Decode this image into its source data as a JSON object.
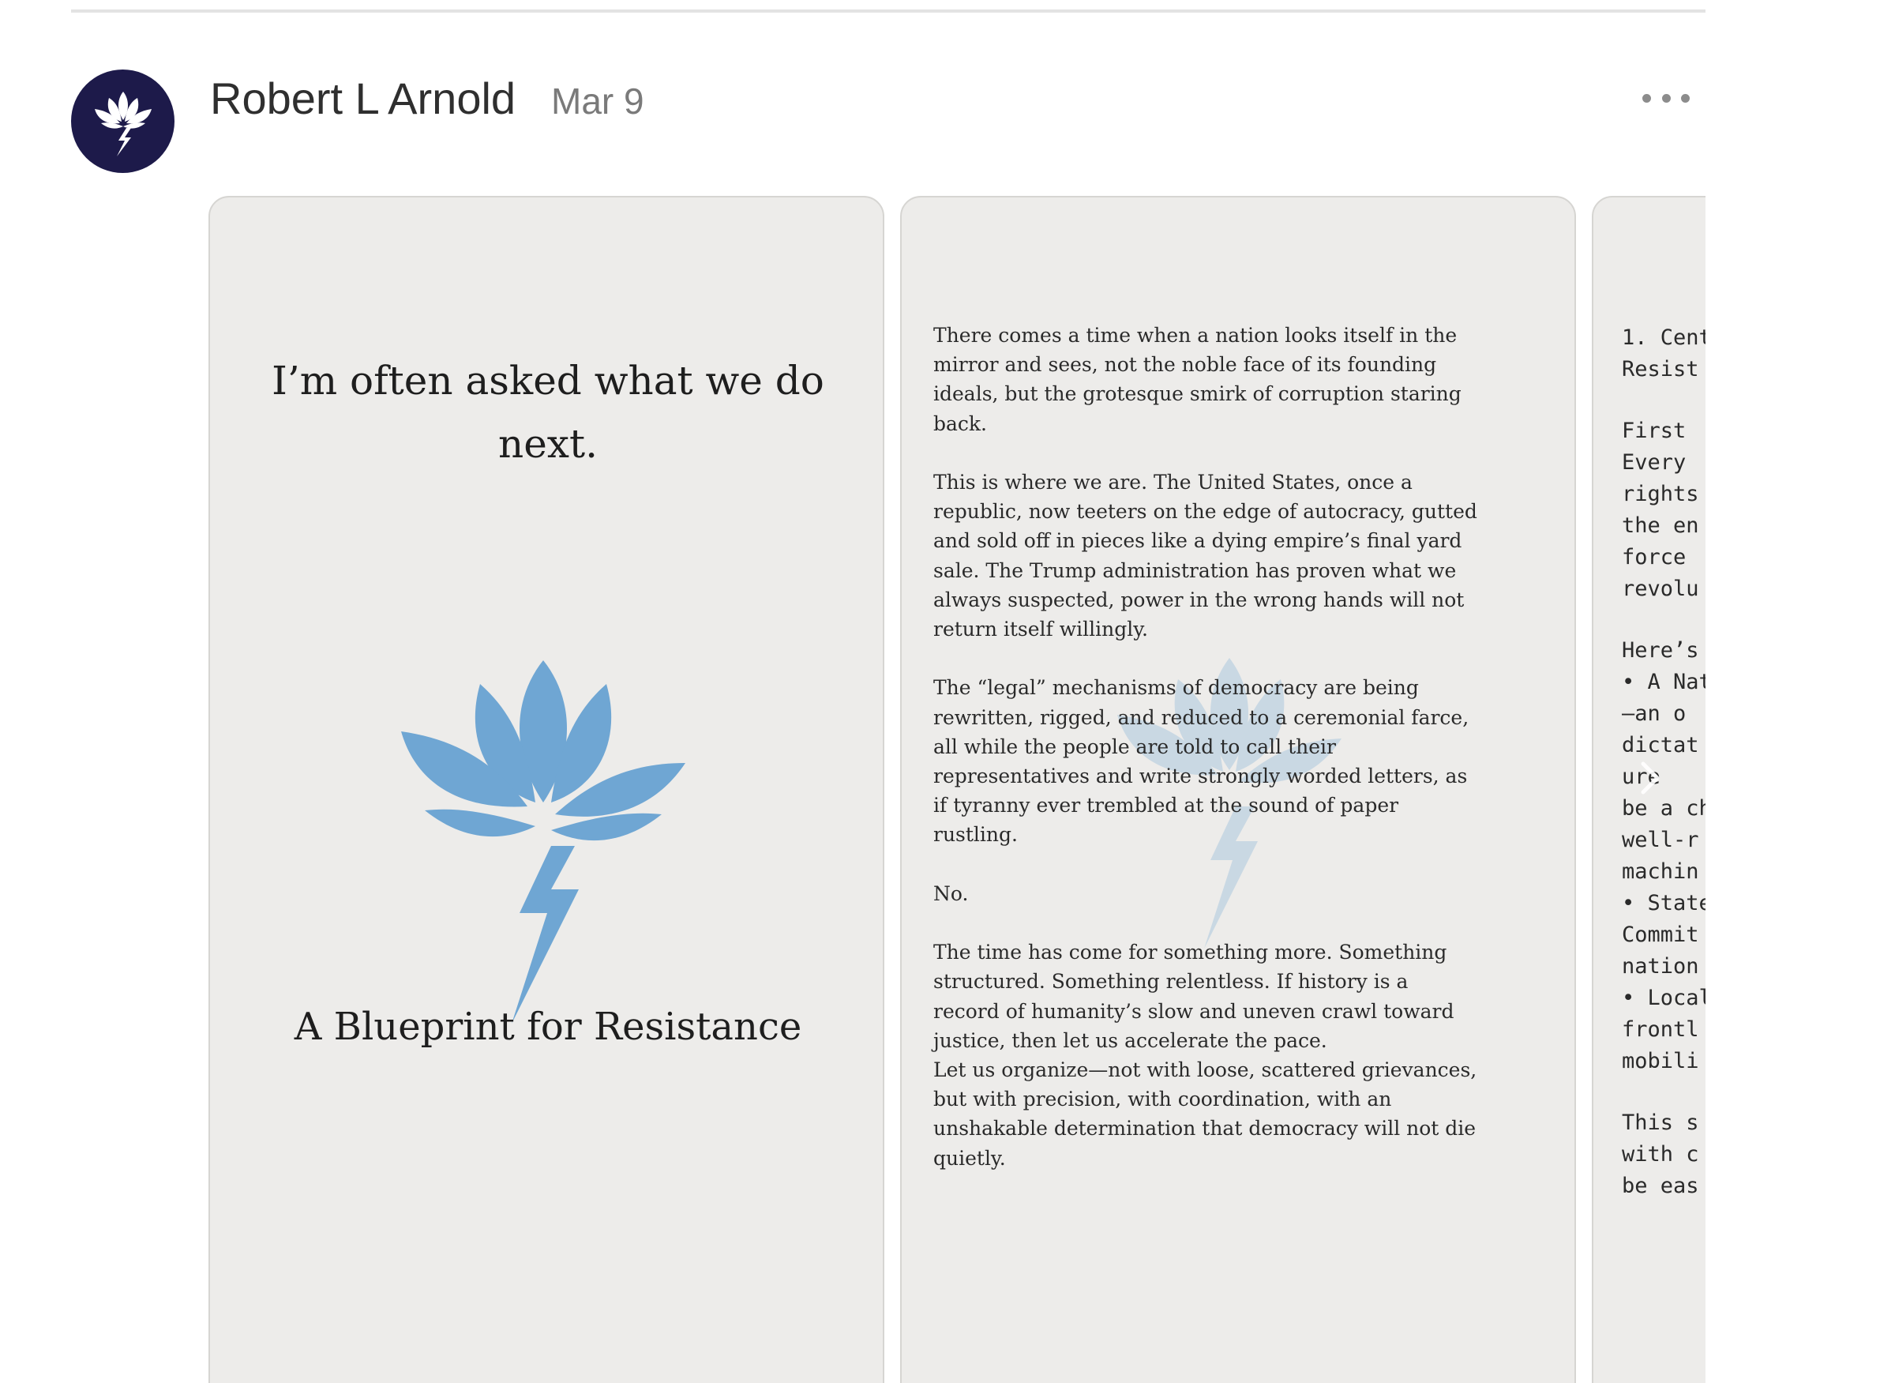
{
  "post": {
    "author": "Robert L Arnold",
    "date": "Mar 9",
    "icons": {
      "avatar": "lotus-lightning-logo",
      "more": "more-horizontal-icon",
      "next": "chevron-right-icon"
    }
  },
  "slides": {
    "slide1": {
      "heading": "I’m often asked what we do next.",
      "subtitle": "A Blueprint for Resistance"
    },
    "slide2": {
      "paragraphs": [
        "There comes a time when a nation looks itself in the\nmirror and sees, not the noble face of its founding\nideals, but the grotesque smirk of corruption staring\nback.",
        "This is where we are. The United States, once a\nrepublic, now teeters on the edge of autocracy, gutted\nand sold off in pieces like a dying empire’s final yard\nsale. The Trump administration has proven what we\nalways suspected, power in the wrong hands will not\nreturn itself willingly.",
        " The “legal” mechanisms of democracy are being\nrewritten, rigged, and reduced to a ceremonial farce,\nall while the people are told to call their\nrepresentatives and write strongly worded letters, as\nif tyranny ever trembled at the sound of paper\nrustling.",
        "No.",
        "The time has come for something more. Something\nstructured. Something relentless. If history is a\nrecord of humanity’s slow and uneven crawl toward\njustice, then let us accelerate the pace.\nLet us organize—not with loose, scattered grievances,\nbut with precision, with coordination, with an\nunshakable determination that democracy will not die\nquietly."
      ]
    },
    "slide3": {
      "lines": [
        "1. Cent",
        "Resist",
        "",
        "First ",
        "Every ",
        "rights",
        "the en",
        "force ",
        "revolu",
        "",
        "Here’s",
        "• A Nat",
        "—an o",
        "dictat",
        " ure",
        "be a ch",
        "well-r",
        "machin",
        "• State",
        "Commit",
        "nation",
        "• Local",
        "frontl",
        "mobili",
        "",
        "This s",
        "with c",
        "be eas"
      ]
    }
  },
  "colors": {
    "avatar_bg": "#1d1a4a",
    "lotus_blue": "#6fa6d3",
    "slide_bg": "#edecea"
  }
}
